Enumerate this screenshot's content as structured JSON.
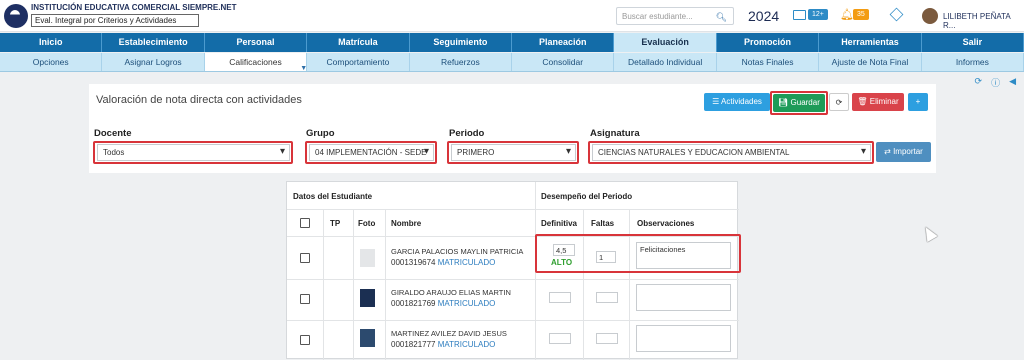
{
  "header": {
    "institution": "INSTITUCIÓN EDUCATIVA COMERCIAL SIEMPRE.NET",
    "mode_select": "Eval. Integral por Criterios y Actividades",
    "search_placeholder": "Buscar estudiante...",
    "year": "2024",
    "mail_count": "12+",
    "notif_count": "35",
    "user": "LILIBETH PEÑATA R..."
  },
  "menu_main": [
    "Inicio",
    "Establecimiento",
    "Personal",
    "Matrícula",
    "Seguimiento",
    "Planeación",
    "Evaluación",
    "Promoción",
    "Herramientas",
    "Salir"
  ],
  "menu_sub": [
    "Opciones",
    "Asignar Logros",
    "Calificaciones",
    "Comportamiento",
    "Refuerzos",
    "Consolidar",
    "Detallado Individual",
    "Notas Finales",
    "Ajuste de Nota Final",
    "Informes"
  ],
  "page": {
    "title": "Valoración de nota directa con actividades",
    "btn_actividades": "Actividades",
    "btn_guardar": "Guardar",
    "btn_eliminar": "Eliminar",
    "btn_importar": "Importar"
  },
  "filters": {
    "docente_label": "Docente",
    "docente_value": "Todos",
    "grupo_label": "Grupo",
    "grupo_value": "04 IMPLEMENTACIÓN - SEDE",
    "periodo_label": "Periodo",
    "periodo_value": "PRIMERO",
    "asignatura_label": "Asignatura",
    "asignatura_value": "CIENCIAS NATURALES Y EDUCACION AMBIENTAL"
  },
  "table": {
    "section_student": "Datos del Estudiante",
    "section_perf": "Desempeño del Periodo",
    "col_tp": "TP",
    "col_foto": "Foto",
    "col_nombre": "Nombre",
    "col_definitiva": "Definitiva",
    "col_faltas": "Faltas",
    "col_obs": "Observaciones",
    "rows": [
      {
        "name": "GARCIA PALACIOS MAYLIN PATRICIA",
        "code": "0001319674",
        "status": "MATRICULADO",
        "grade": "4,5",
        "level": "ALTO",
        "faltas": "1",
        "obs": "Felicitaciones"
      },
      {
        "name": "GIRALDO ARAUJO ELIAS MARTIN",
        "code": "0001821769",
        "status": "MATRICULADO",
        "grade": "",
        "level": "",
        "faltas": "",
        "obs": ""
      },
      {
        "name": "MARTINEZ AVILEZ DAVID JESUS",
        "code": "0001821777",
        "status": "MATRICULADO",
        "grade": "",
        "level": "",
        "faltas": "",
        "obs": ""
      }
    ]
  },
  "colors": {
    "menu": "#136ca8",
    "submenu": "#c9e7f6",
    "highlight": "#d8343a",
    "level_alto": "#2e9e2e"
  },
  "icons": [
    "search-icon",
    "mail-icon",
    "bell-icon",
    "cube-icon",
    "refresh-icon",
    "info-icon",
    "back-icon",
    "plus-icon",
    "caret-down-icon",
    "trash-icon",
    "save-icon",
    "list-icon",
    "swap-icon"
  ]
}
